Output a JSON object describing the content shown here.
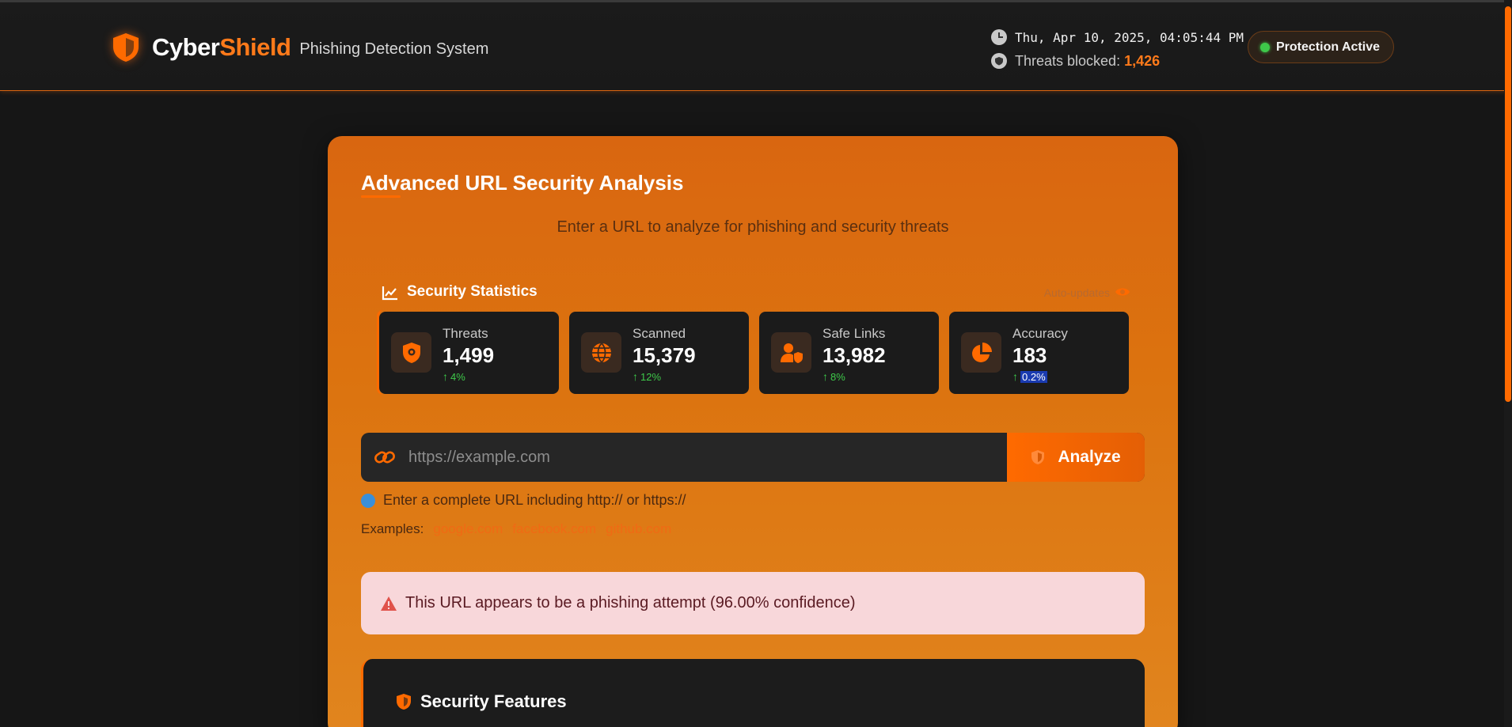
{
  "header": {
    "brand_part1": "Cyber",
    "brand_part2": "Shield",
    "subtitle": "Phishing Detection System",
    "datetime": "Thu, Apr 10, 2025, 04:05:44 PM",
    "blocked_label": "Threats blocked:",
    "blocked_value": "1,426",
    "protection_status": "Protection Active"
  },
  "main": {
    "title": "Advanced URL Security Analysis",
    "subtitle": "Enter a URL to analyze for phishing and security threats"
  },
  "stats": {
    "title": "Security Statistics",
    "auto_updates": "Auto-updates",
    "items": [
      {
        "label": "Threats",
        "value": "1,499",
        "trend": "4%",
        "icon": "shield-virus-icon"
      },
      {
        "label": "Scanned",
        "value": "15,379",
        "trend": "12%",
        "icon": "globe-icon"
      },
      {
        "label": "Safe Links",
        "value": "13,982",
        "trend": "8%",
        "icon": "user-shield-icon"
      },
      {
        "label": "Accuracy",
        "value": "183",
        "trend": "0.2%",
        "icon": "pie-chart-icon"
      }
    ]
  },
  "url_form": {
    "placeholder": "https://example.com",
    "value": "",
    "analyze_label": "Analyze",
    "hint": "Enter a complete URL including http:// or https://",
    "examples_label": "Examples:",
    "examples": [
      "google.com",
      "facebook.com",
      "github.com"
    ]
  },
  "alert": {
    "message": "This URL appears to be a phishing attempt (96.00% confidence)"
  },
  "features": {
    "title": "Security Features"
  },
  "colors": {
    "accent": "#ff6a00",
    "success": "#3ec94a",
    "danger_bg": "#f8d7da"
  }
}
